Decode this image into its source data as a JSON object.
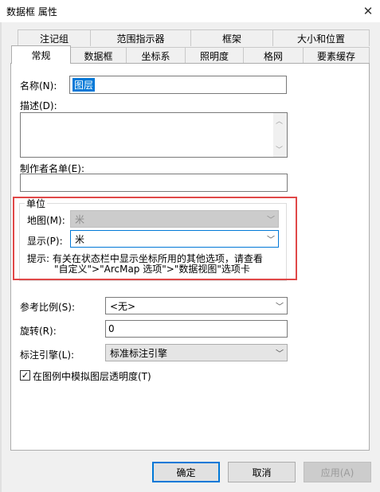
{
  "window": {
    "title": "数据框 属性",
    "close_glyph": "✕"
  },
  "tabs_row1": [
    "注记组",
    "范围指示器",
    "框架",
    "大小和位置"
  ],
  "tabs_row2": [
    "常规",
    "数据框",
    "坐标系",
    "照明度",
    "格网",
    "要素缓存"
  ],
  "general": {
    "name_label": "名称(N):",
    "name_value": "图层",
    "description_label": "描述(D):",
    "description_value": "",
    "credits_label": "制作者名单(E):",
    "credits_value": ""
  },
  "units": {
    "group_label": "单位",
    "map_label": "地图(M):",
    "map_value": "米",
    "display_label": "显示(P):",
    "display_value": "米",
    "hint_line1": "提示: 有关在状态栏中显示坐标所用的其他选项，请查看",
    "hint_line2": "\"自定义\">\"ArcMap 选项\">\"数据视图\"选项卡"
  },
  "reference_scale": {
    "label": "参考比例(S):",
    "value": "<无>"
  },
  "rotation": {
    "label": "旋转(R):",
    "value": "0"
  },
  "label_engine": {
    "label": "标注引擎(L):",
    "value": "标准标注引擎"
  },
  "simulate_transparency": {
    "label": "在图例中模拟图层透明度(T)",
    "checked": true,
    "check_glyph": "✓"
  },
  "buttons": {
    "ok": "确定",
    "cancel": "取消",
    "apply": "应用(A)"
  },
  "arrow_glyph": "﹀",
  "colors": {
    "accent": "#0078d7",
    "highlight_border": "#e04848",
    "selection": "#0078d7"
  }
}
